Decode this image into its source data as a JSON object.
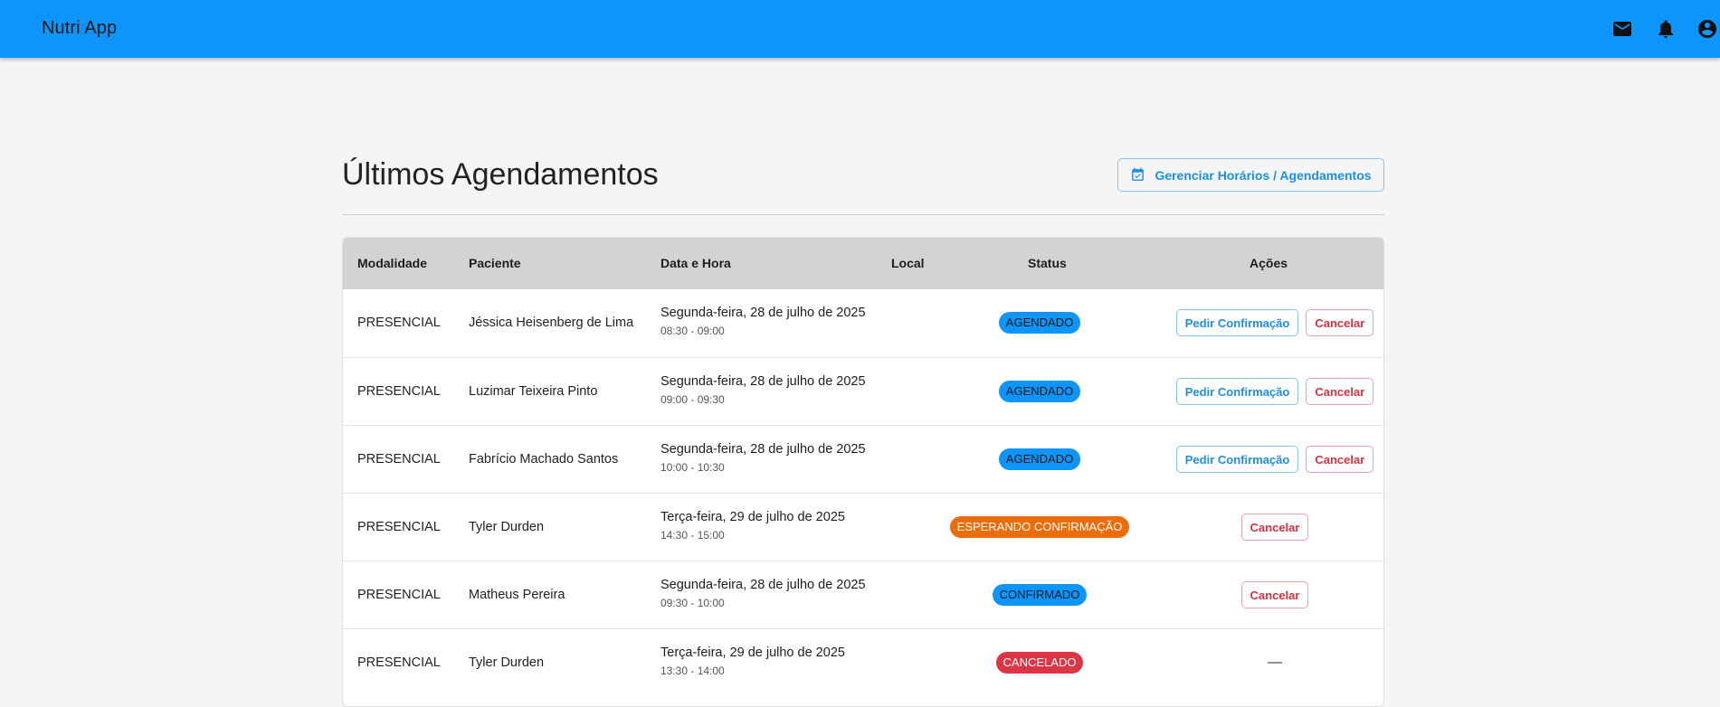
{
  "appbar": {
    "title": "Nutri App",
    "icons": [
      "mail-icon",
      "bell-icon",
      "account-circle-icon"
    ]
  },
  "page": {
    "title": "Últimos Agendamentos",
    "manage_button": "Gerenciar Horários / Agendamentos"
  },
  "table": {
    "headers": {
      "modalidade": "Modalidade",
      "paciente": "Paciente",
      "data_hora": "Data e Hora",
      "local": "Local",
      "status": "Status",
      "acoes": "Ações"
    },
    "rows": [
      {
        "modalidade": "PRESENCIAL",
        "paciente": "Jéssica Heisenberg de Lima",
        "data": "Segunda-feira, 28 de julho de 2025",
        "hora": "08:30 - 09:00",
        "local": "",
        "status": "AGENDADO",
        "status_color": "#0d95fb",
        "actions": [
          "Pedir Confirmação",
          "Cancelar"
        ]
      },
      {
        "modalidade": "PRESENCIAL",
        "paciente": "Luzimar Teixeira Pinto",
        "data": "Segunda-feira, 28 de julho de 2025",
        "hora": "09:00 - 09:30",
        "local": "",
        "status": "AGENDADO",
        "status_color": "#0d95fb",
        "actions": [
          "Pedir Confirmação",
          "Cancelar"
        ]
      },
      {
        "modalidade": "PRESENCIAL",
        "paciente": "Fabrício Machado Santos",
        "data": "Segunda-feira, 28 de julho de 2025",
        "hora": "10:00 - 10:30",
        "local": "",
        "status": "AGENDADO",
        "status_color": "#0d95fb",
        "actions": [
          "Pedir Confirmação",
          "Cancelar"
        ]
      },
      {
        "modalidade": "PRESENCIAL",
        "paciente": "Tyler Durden",
        "data": "Terça-feira, 29 de julho de 2025",
        "hora": "14:30 - 15:00",
        "local": "",
        "status": "ESPERANDO CONFIRMAÇÃO",
        "status_color": "#ec6c0b",
        "actions": [
          "Cancelar"
        ]
      },
      {
        "modalidade": "PRESENCIAL",
        "paciente": "Matheus Pereira",
        "data": "Segunda-feira, 28 de julho de 2025",
        "hora": "09:30 - 10:00",
        "local": "",
        "status": "CONFIRMADO",
        "status_color": "#0d95fb",
        "actions": [
          "Cancelar"
        ]
      },
      {
        "modalidade": "PRESENCIAL",
        "paciente": "Tyler Durden",
        "data": "Terça-feira, 29 de julho de 2025",
        "hora": "13:30 - 14:00",
        "local": "",
        "status": "CANCELADO",
        "status_color": "#dc3545",
        "actions": [
          "—"
        ]
      }
    ]
  },
  "colors": {
    "appbar": "#0d95fb",
    "primary": "#1b8fe6",
    "danger": "#d6313e",
    "warning": "#ec6c0b"
  }
}
